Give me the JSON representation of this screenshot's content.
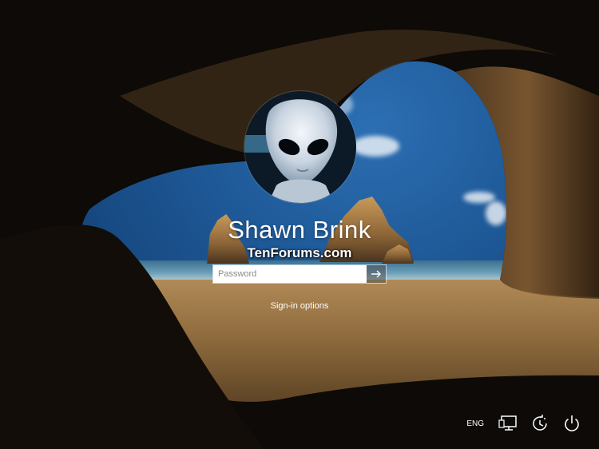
{
  "user": {
    "display_name": "Shawn Brink"
  },
  "watermark": {
    "text": "TenForums.com"
  },
  "password": {
    "placeholder": "Password",
    "value": ""
  },
  "signin_options": {
    "label": "Sign-in options"
  },
  "tray": {
    "language": "ENG",
    "icons": [
      "network-icon",
      "ease-of-access-icon",
      "power-icon"
    ]
  },
  "colors": {
    "text": "#ffffff",
    "submit_bg": "#505050"
  }
}
